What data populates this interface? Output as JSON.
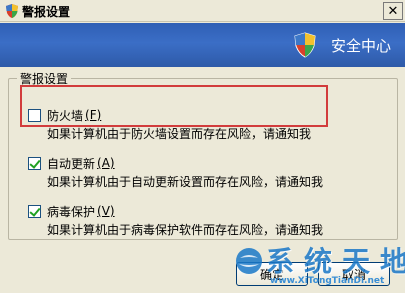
{
  "window": {
    "title": "警报设置",
    "close_label": "✕"
  },
  "header": {
    "text": "安全中心"
  },
  "group": {
    "legend": "警报设置",
    "options": [
      {
        "label": "防火墙",
        "key": "(F)",
        "checked": false,
        "description": "如果计算机由于防火墙设置而存在风险，请通知我"
      },
      {
        "label": "自动更新",
        "key": "(A)",
        "checked": true,
        "description": "如果计算机由于自动更新设置而存在风险，请通知我"
      },
      {
        "label": "病毒保护",
        "key": "(V)",
        "checked": true,
        "description": "如果计算机由于病毒保护软件而存在风险，请通知我"
      }
    ]
  },
  "buttons": {
    "ok": "确定",
    "cancel": "取消"
  },
  "watermark": {
    "text": "系统天地",
    "url": "www.XiTongTianDi.net"
  },
  "colors": {
    "header_blue": "#3b6ec6",
    "highlight_red": "#d23c3c",
    "watermark_blue": "#1a78c8"
  }
}
